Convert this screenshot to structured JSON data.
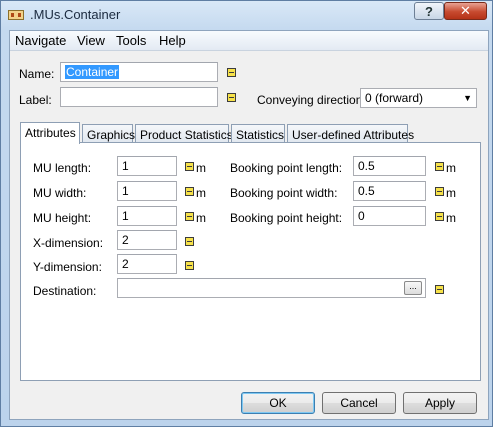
{
  "window": {
    "title": ".MUs.Container"
  },
  "menu": [
    "Navigate",
    "View",
    "Tools",
    "Help"
  ],
  "form": {
    "name_label": "Name:",
    "name_value": "Container",
    "label_label": "Label:",
    "label_value": "",
    "conveying_label": "Conveying direction:",
    "conveying_value": "0 (forward)"
  },
  "tabs": [
    "Attributes",
    "Graphics",
    "Product Statistics",
    "Statistics",
    "User-defined Attributes"
  ],
  "attributes": {
    "mu_length_label": "MU length:",
    "mu_length_value": "1",
    "mu_width_label": "MU width:",
    "mu_width_value": "1",
    "mu_height_label": "MU height:",
    "mu_height_value": "1",
    "xdim_label": "X-dimension:",
    "xdim_value": "2",
    "ydim_label": "Y-dimension:",
    "ydim_value": "2",
    "destination_label": "Destination:",
    "destination_value": "",
    "bp_length_label": "Booking point length:",
    "bp_length_value": "0.5",
    "bp_width_label": "Booking point width:",
    "bp_width_value": "0.5",
    "bp_height_label": "Booking point height:",
    "bp_height_value": "0",
    "unit": "m",
    "browse_label": "..."
  },
  "buttons": {
    "ok": "OK",
    "cancel": "Cancel",
    "apply": "Apply"
  },
  "title_buttons": {
    "help": "?",
    "close": "✕"
  }
}
